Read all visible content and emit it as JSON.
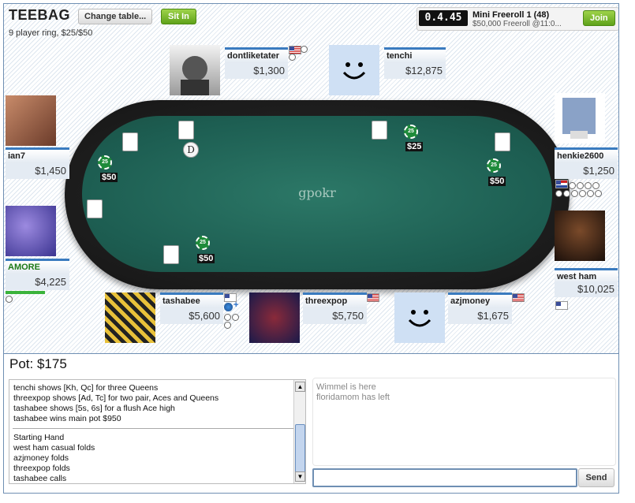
{
  "header": {
    "title": "TEEBAG",
    "subtitle": "9 player ring, $25/$50",
    "change_table_label": "Change table...",
    "sit_in_label": "Sit In"
  },
  "tournament": {
    "clock": "0.4.45",
    "name": "Mini Freeroll 1 (48)",
    "details": "$50,000 Freeroll @11:0...",
    "join_label": "Join"
  },
  "table": {
    "brand": "gpokr",
    "dealer_button": "D",
    "bets": [
      {
        "chip": "25",
        "amount": "$50"
      },
      {
        "chip": "25",
        "amount": "$25"
      },
      {
        "chip": "25",
        "amount": "$50"
      },
      {
        "chip": "25",
        "amount": "$50"
      }
    ]
  },
  "seats": [
    {
      "name": "dontliketater",
      "stack": "$1,300"
    },
    {
      "name": "tenchi",
      "stack": "$12,875"
    },
    {
      "name": "ian7",
      "stack": "$1,450"
    },
    {
      "name": "henkie2600",
      "stack": "$1,250"
    },
    {
      "name": "AMORE",
      "stack": "$4,225"
    },
    {
      "name": "west ham casu",
      "stack": "$10,025"
    },
    {
      "name": "tashabee",
      "stack": "$5,600"
    },
    {
      "name": "threexpop",
      "stack": "$5,750"
    },
    {
      "name": "azjmoney",
      "stack": "$1,675"
    }
  ],
  "pot": "Pot: $175",
  "hand_log": [
    "tenchi shows [Kh, Qc] for three Queens",
    "threexpop shows [Ad, Tc] for two pair, Aces and Queens",
    "tashabee shows [5s, 6s] for a flush Ace high",
    "tashabee wins main pot $950"
  ],
  "hand_log_2": [
    "Starting Hand",
    "west ham casual folds",
    "azjmoney folds",
    "threexpop folds",
    "tashabee calls"
  ],
  "chat": [
    "Wimmel is here",
    "floridamom has left"
  ],
  "send_label": "Send",
  "colors": {
    "felt": "#1d5e52",
    "accent": "#3a7bbf",
    "green_button": "#5fa21a"
  }
}
